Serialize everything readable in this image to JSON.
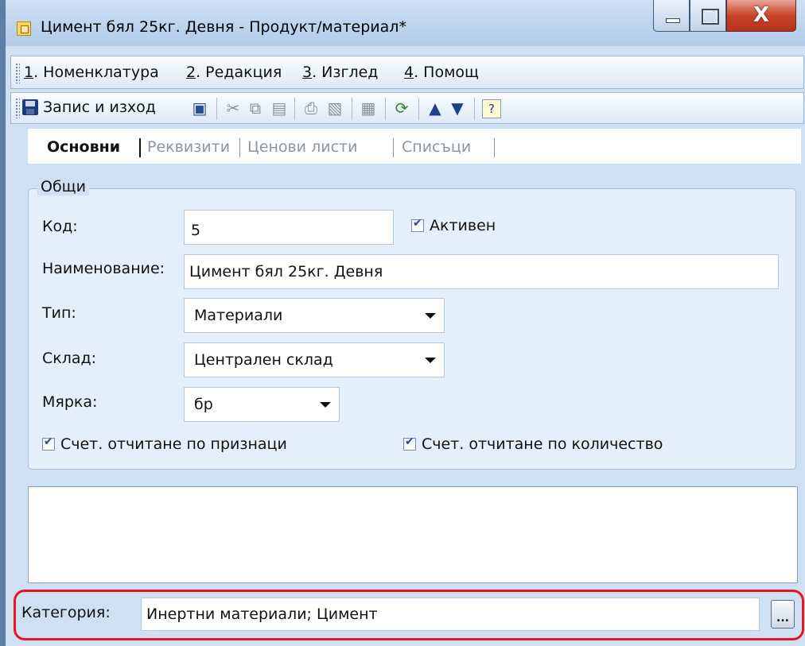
{
  "window": {
    "title": "Цимент бял 25кг. Девня - Продукт/материал*",
    "close_glyph": "X"
  },
  "menu": {
    "items": [
      {
        "key": "1",
        "label": ". Номенклатура"
      },
      {
        "key": "2",
        "label": ". Редакция"
      },
      {
        "key": "3",
        "label": ". Изглед"
      },
      {
        "key": "4",
        "label": ". Помощ"
      }
    ]
  },
  "toolbar": {
    "save_exit_label": "Запис и изход",
    "icons": [
      "save-icon",
      "cut-icon",
      "copy-icon",
      "paste-icon",
      "print-icon",
      "print-preview-icon",
      "calculator-icon",
      "refresh-icon",
      "arrow-up-icon",
      "arrow-down-icon",
      "help-icon"
    ]
  },
  "tabs": [
    {
      "label": "Основни",
      "active": true
    },
    {
      "label": "Реквизити",
      "active": false
    },
    {
      "label": "Ценови листи",
      "active": false
    },
    {
      "label": "Списъци",
      "active": false
    }
  ],
  "general": {
    "title": "Общи",
    "code_label": "Код:",
    "code_value": "5",
    "active_label": "Активен",
    "active_checked": true,
    "name_label": "Наименование:",
    "name_value": "Цимент бял 25кг. Девня",
    "type_label": "Тип:",
    "type_value": "Материали",
    "warehouse_label": "Склад:",
    "warehouse_value": "Централен склад",
    "unit_label": "Мярка:",
    "unit_value": "бр",
    "acc_by_attr_label": "Счет. отчитане по признаци",
    "acc_by_attr_checked": true,
    "acc_by_qty_label": "Счет. отчитане по количество",
    "acc_by_qty_checked": true
  },
  "category": {
    "label": "Категория:",
    "value": "Инертни материали; Цимент",
    "button_label": "..."
  },
  "colors": {
    "highlight": "#e8161f",
    "window_bg": "#cfe0f3",
    "close_button": "#c8432a"
  }
}
